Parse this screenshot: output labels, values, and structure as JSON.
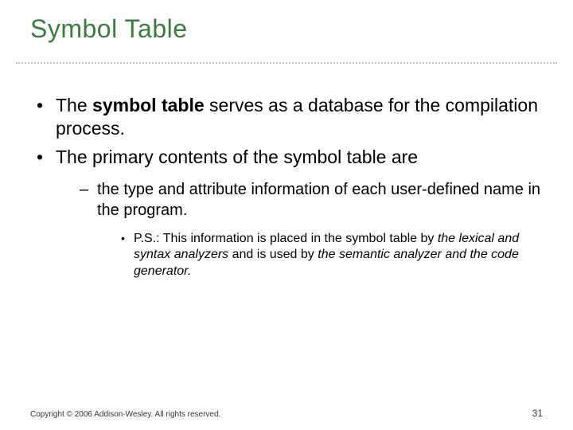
{
  "title": "Symbol Table",
  "bullets": {
    "b1_pre": "The ",
    "b1_bold": "symbol table",
    "b1_post": " serves as a database for the compilation process.",
    "b2": "The primary contents of the symbol table are",
    "sub1": "the type and attribute information of each user-defined name in the program.",
    "subsub_pre": "P.S.: This information is placed in the symbol table by ",
    "subsub_it1": "the lexical and syntax analyzers",
    "subsub_mid": " and is used by ",
    "subsub_it2": "the semantic analyzer and the code generator.",
    "subsub_end": ""
  },
  "footer": {
    "copyright": "Copyright © 2006 Addison-Wesley. All rights reserved.",
    "page": "31"
  }
}
